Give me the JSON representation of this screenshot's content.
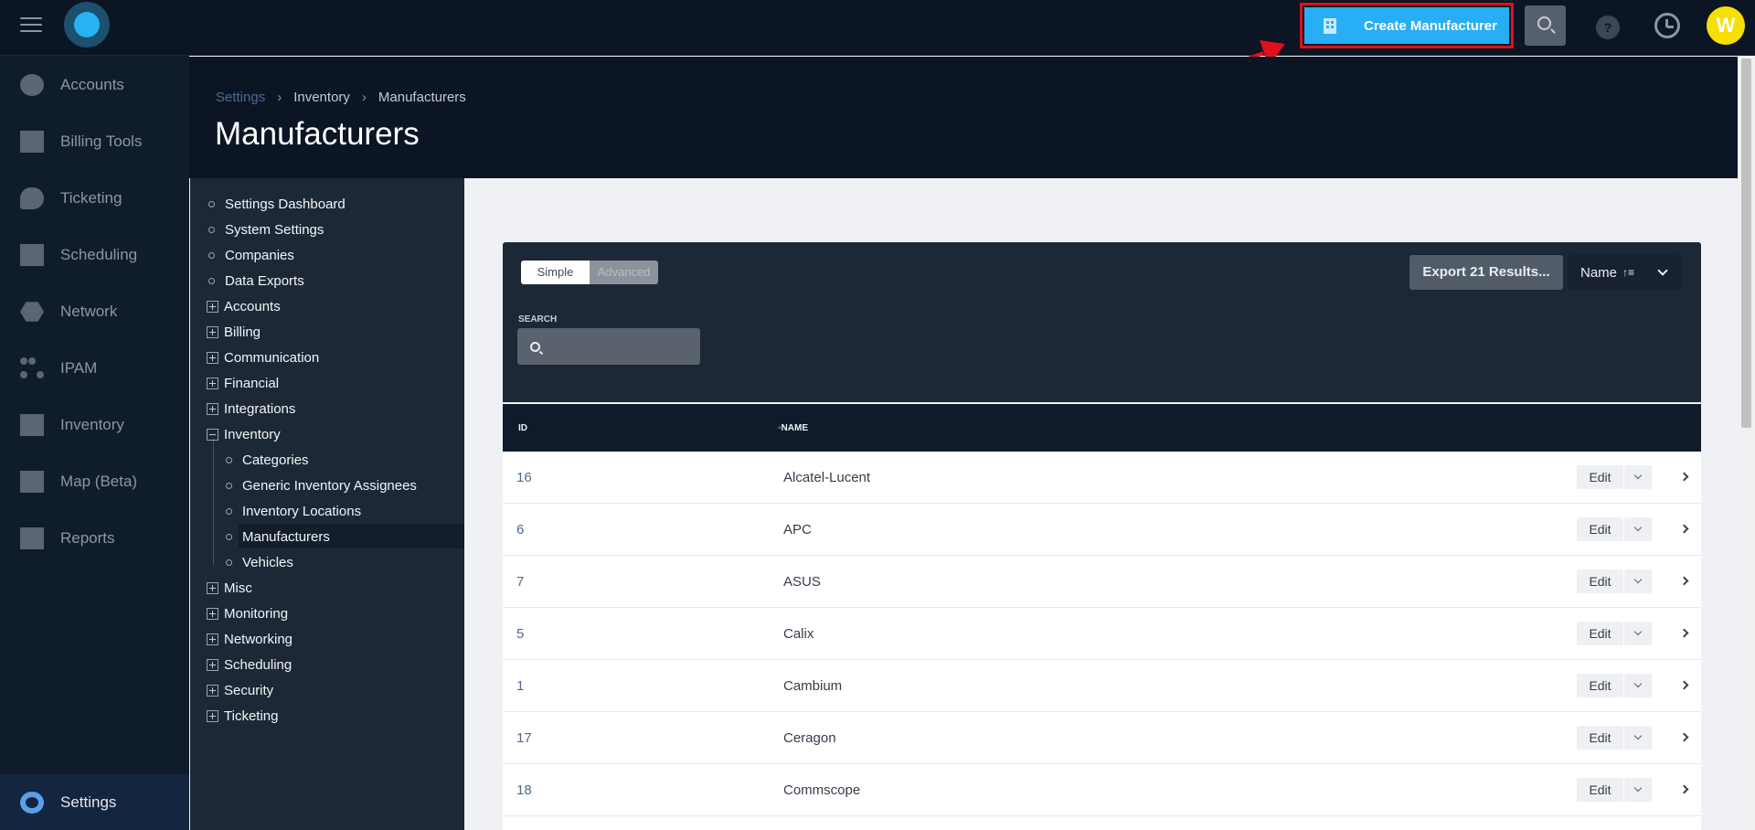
{
  "topbar": {
    "create_button": "Create Manufacturer",
    "help_glyph": "?",
    "avatar_initial": "W",
    "icons": [
      "menu-icon",
      "logo-icon",
      "building-icon",
      "search-icon",
      "help-icon",
      "history-icon"
    ]
  },
  "sidebar": {
    "items": [
      {
        "label": "Accounts",
        "icon": "user-icon"
      },
      {
        "label": "Billing Tools",
        "icon": "abacus-icon"
      },
      {
        "label": "Ticketing",
        "icon": "chat-icon"
      },
      {
        "label": "Scheduling",
        "icon": "calendar-icon"
      },
      {
        "label": "Network",
        "icon": "network-icon"
      },
      {
        "label": "IPAM",
        "icon": "ipam-icon"
      },
      {
        "label": "Inventory",
        "icon": "cart-icon"
      },
      {
        "label": "Map (Beta)",
        "icon": "map-icon"
      },
      {
        "label": "Reports",
        "icon": "report-icon"
      }
    ],
    "settings": {
      "label": "Settings",
      "icon": "gear-icon"
    }
  },
  "header": {
    "breadcrumb": [
      "Settings",
      "Inventory",
      "Manufacturers"
    ],
    "separator": "›",
    "title": "Manufacturers"
  },
  "tree": {
    "top": [
      "Settings Dashboard",
      "System Settings",
      "Companies",
      "Data Exports"
    ],
    "groups_a": [
      "Accounts",
      "Billing",
      "Communication",
      "Financial",
      "Integrations"
    ],
    "inventory": "Inventory",
    "inventory_children": [
      "Categories",
      "Generic Inventory Assignees",
      "Inventory Locations",
      "Manufacturers",
      "Vehicles"
    ],
    "groups_b": [
      "Misc",
      "Monitoring",
      "Networking",
      "Scheduling",
      "Security",
      "Ticketing"
    ],
    "active": "Manufacturers"
  },
  "filters": {
    "mode_simple": "Simple",
    "mode_advanced": "Advanced",
    "export_button": "Export 21 Results...",
    "sort_label": "Name",
    "sort_icon": "↑≡",
    "search_label": "SEARCH",
    "search_value": ""
  },
  "table": {
    "columns": [
      "ID",
      "NAME"
    ],
    "sort_marker": "◦",
    "edit_label": "Edit",
    "rows": [
      {
        "id": "16",
        "name": "Alcatel-Lucent"
      },
      {
        "id": "6",
        "name": "APC"
      },
      {
        "id": "7",
        "name": "ASUS"
      },
      {
        "id": "5",
        "name": "Calix"
      },
      {
        "id": "1",
        "name": "Cambium"
      },
      {
        "id": "17",
        "name": "Ceragon"
      },
      {
        "id": "18",
        "name": "Commscope"
      }
    ]
  },
  "colors": {
    "topbar_bg": "#0b1524",
    "accent_blue": "#27aef4",
    "annotation_red": "#e0101c",
    "avatar_yellow": "#f5e000"
  }
}
